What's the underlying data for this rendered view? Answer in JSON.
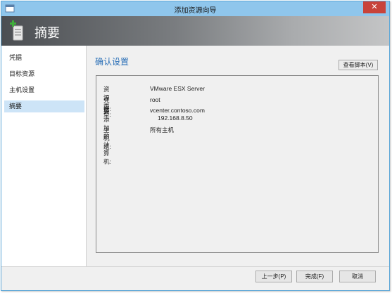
{
  "window": {
    "title": "添加资源向导",
    "close_glyph": "✕"
  },
  "header": {
    "title": "摘要",
    "icon": "server-add-icon"
  },
  "nav": {
    "items": [
      {
        "label": "凭据"
      },
      {
        "label": "目标资源"
      },
      {
        "label": "主机设置"
      },
      {
        "label": "摘要",
        "selected": true
      }
    ]
  },
  "content": {
    "section_title": "确认设置",
    "view_script_label": "查看脚本(V)",
    "summary": {
      "resource_type": {
        "label": "资源类型:",
        "value": "VMware ESX Server"
      },
      "credentials": {
        "label": "凭据:",
        "value": "root"
      },
      "computers": {
        "label": "要添加的计算机:",
        "value": "vcenter.contoso.com",
        "value2": "192.168.8.50"
      },
      "host_group": {
        "label": "主机组:",
        "value": "所有主机"
      }
    }
  },
  "footer": {
    "prev_label": "上一步(P)",
    "finish_label": "完成(F)",
    "cancel_label": "取消"
  },
  "colors": {
    "titlebar": "#8fc6ec",
    "accent_title": "#2a6fb7",
    "selected_nav": "#cde4f7",
    "close_button": "#c8433a"
  }
}
